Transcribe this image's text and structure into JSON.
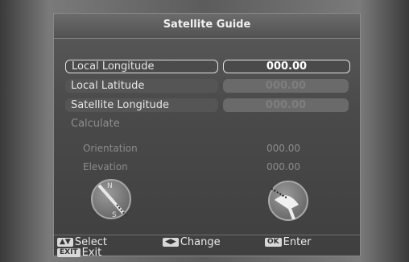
{
  "window": {
    "title": "Satellite Guide"
  },
  "fields": [
    {
      "label": "Local Longitude",
      "value": "000.00"
    },
    {
      "label": "Local Latitude",
      "value": "000.00"
    },
    {
      "label": "Satellite Longitude",
      "value": "000.00"
    }
  ],
  "calculate_label": "Calculate",
  "results": {
    "orientation_label": "Orientation",
    "orientation_value": "000.00",
    "elevation_label": "Elevation",
    "elevation_value": "000.00"
  },
  "compass": {
    "north": "N",
    "south": "S"
  },
  "footer": {
    "select_key": "▲▼",
    "select_label": "Select",
    "change_key": "◀▶",
    "change_label": "Change",
    "ok_key": "OK",
    "enter_label": "Enter",
    "exit_key": "EXIT",
    "exit_label": "Exit"
  }
}
